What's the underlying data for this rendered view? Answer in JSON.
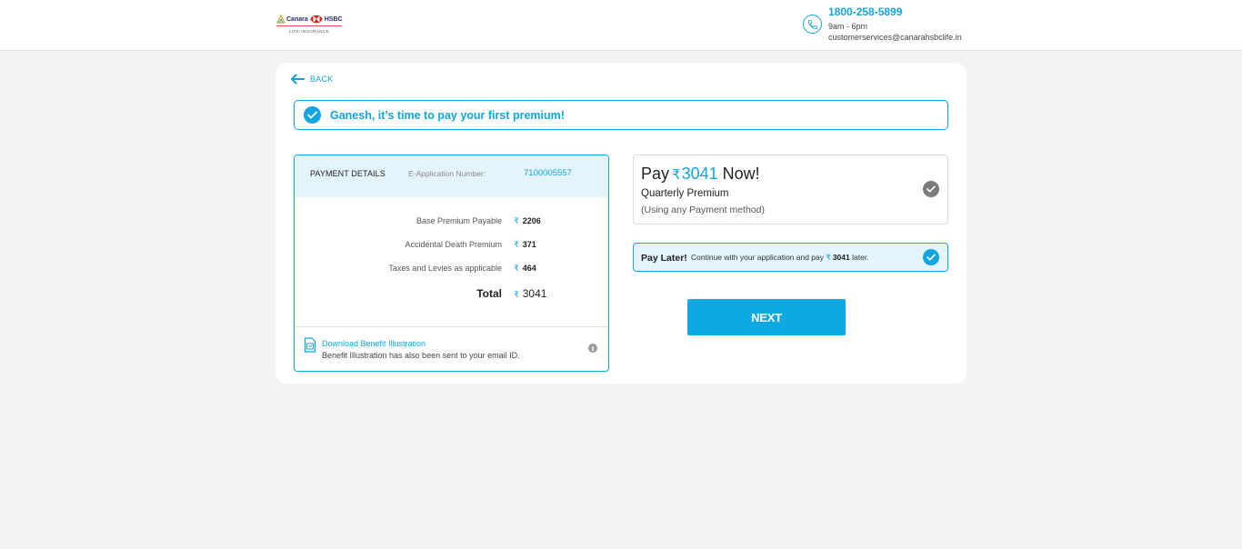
{
  "header": {
    "logo": {
      "brand_left": "Canara",
      "brand_right": "HSBC",
      "subtitle": "LIFE INSURANCE"
    },
    "contact": {
      "icon": "phone-icon",
      "phone": "1800-258-5899",
      "hours": "9am - 6pm",
      "email": "customerservices@canarahsbclife.in"
    }
  },
  "main": {
    "back_label": "BACK",
    "greeting": "Ganesh, it’s time to pay your first premium!",
    "payment_details": {
      "title": "PAYMENT DETAILS",
      "app_label": "E-Application Number:",
      "app_number": "7100005557",
      "currency_symbol": "₹",
      "rows": [
        {
          "label": "Base Premium Payable",
          "value": "2206"
        },
        {
          "label": "Accidental Death Premium",
          "value": "371"
        },
        {
          "label": "Taxes and Levies as applicable",
          "value": "464"
        }
      ],
      "total_label": "Total",
      "total_value": "3041",
      "download_label": "Download Benefit Illustration",
      "download_note": "Benefit Illustration has also been sent to your email ID.",
      "info_glyph": "i"
    },
    "pay_now": {
      "prefix": "Pay",
      "amount": "3041",
      "suffix": "Now!",
      "plan": "Quarterly Premium",
      "note": "(Using any Payment method)",
      "selected": false
    },
    "pay_later": {
      "title": "Pay Later!",
      "text_before": "Continue with your application and pay",
      "amount": "3041",
      "text_after": "later.",
      "selected": true
    },
    "next_label": "NEXT"
  },
  "colors": {
    "accent": "#12a5df",
    "light_accent": "#e4f4fb",
    "background": "#f3f3f3",
    "unselected_check": "#7b7b7b"
  }
}
